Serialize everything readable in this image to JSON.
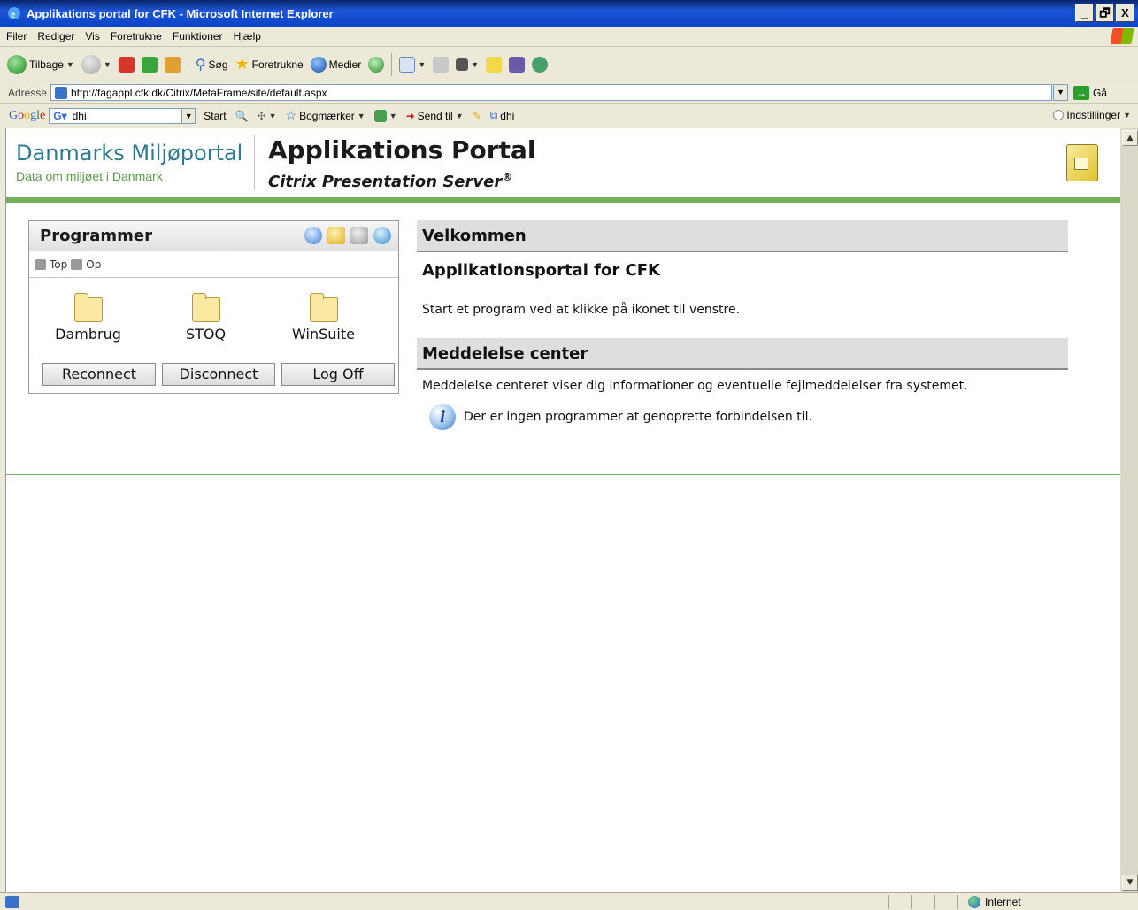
{
  "window": {
    "title": "Applikations portal for CFK - Microsoft Internet Explorer",
    "buttons": [
      "_",
      "🗗",
      "X"
    ]
  },
  "menu": [
    "Filer",
    "Rediger",
    "Vis",
    "Foretrukne",
    "Funktioner",
    "Hjælp"
  ],
  "toolbar": {
    "back": "Tilbage",
    "search": "Søg",
    "favorites": "Foretrukne",
    "media": "Medier"
  },
  "address": {
    "label": "Adresse",
    "url": "http://fagappl.cfk.dk/Citrix/MetaFrame/site/default.aspx",
    "go": "Gå"
  },
  "google": {
    "logo": "Google",
    "search_value": "dhi",
    "start": "Start",
    "bookmarks": "Bogmærker",
    "send_to": "Send til",
    "highlight_term": "dhi",
    "settings": "Indstillinger"
  },
  "header": {
    "logo_title": "Danmarks Miljøportal",
    "logo_sub": "Data om miljøet i Danmark",
    "app_title": "Applikations Portal",
    "app_sub": "Citrix Presentation Server",
    "app_sub_mark": "®"
  },
  "programs": {
    "title": "Programmer",
    "crumb_top": "Top",
    "crumb_up": "Op",
    "folders": [
      "Dambrug",
      "STOQ",
      "WinSuite"
    ],
    "buttons": {
      "reconnect": "Reconnect",
      "disconnect": "Disconnect",
      "logoff": "Log Off"
    }
  },
  "welcome": {
    "heading": "Velkommen",
    "title": "Applikationsportal for CFK",
    "text": "Start et program ved at klikke på ikonet til venstre."
  },
  "messages": {
    "heading": "Meddelelse center",
    "text": "Meddelelse centeret viser dig informationer og eventuelle fejlmeddelelser fra systemet.",
    "info": "Der er ingen programmer at genoprette forbindelsen til."
  },
  "status": {
    "zone": "Internet"
  }
}
